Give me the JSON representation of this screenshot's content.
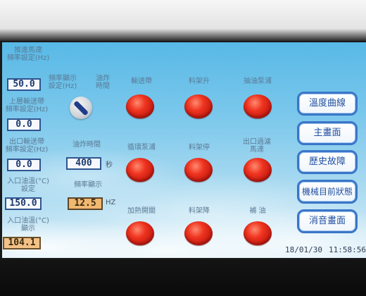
{
  "left_panel": {
    "feed_motor_freq_label_1": "推進馬達",
    "feed_motor_freq_label_2": "頻率設定(Hz)",
    "feed_motor_freq_value": "50.0",
    "upper_conveyor_freq_label_1": "上層輸送帶",
    "upper_conveyor_freq_label_2": "頻率設定(Hz)",
    "upper_conveyor_freq_value": "0.0",
    "outlet_conveyor_freq_label_1": "出口輸送帶",
    "outlet_conveyor_freq_label_2": "頻率設定(Hz)",
    "outlet_conveyor_freq_value": "0.0",
    "inlet_oil_temp_set_label_1": "入口油溫(°C)",
    "inlet_oil_temp_set_label_2": "設定",
    "inlet_oil_temp_set_value": "150.0",
    "inlet_oil_temp_display_label_1": "入口油溫(°C)",
    "inlet_oil_temp_display_label_2": "顯示",
    "inlet_oil_temp_display_value": "104.1"
  },
  "middle_panel": {
    "freq_display_set_label_1": "頻率顯示",
    "freq_display_set_label_2": "設定(Hz)",
    "fry_time_label_1": "油炸",
    "fry_time_label_2": "時間",
    "fry_time_set_label": "油炸時間",
    "fry_time_value": "400",
    "fry_time_unit": "秒",
    "freq_display_label": "頻率顯示",
    "freq_display_value": "12.5",
    "freq_display_unit": "HZ"
  },
  "controls": {
    "row1": [
      "輸送帶",
      "料架升",
      "抽油泵浦"
    ],
    "row2": [
      "循環泵浦",
      "料架停",
      "出口過濾馬達"
    ],
    "row3": [
      "加熱開關",
      "料架降",
      "補 油"
    ]
  },
  "nav_buttons": [
    "溫度曲線",
    "主畫面",
    "歷史故障",
    "機械目前狀態",
    "消音畫面"
  ],
  "status": {
    "date": "18/01/30",
    "time": "11:58:56"
  },
  "colors": {
    "button_red": "#e02818",
    "nav_border": "#3a76c8",
    "value_box_border": "#2e5590",
    "highlight_orange": "#f2c286"
  }
}
